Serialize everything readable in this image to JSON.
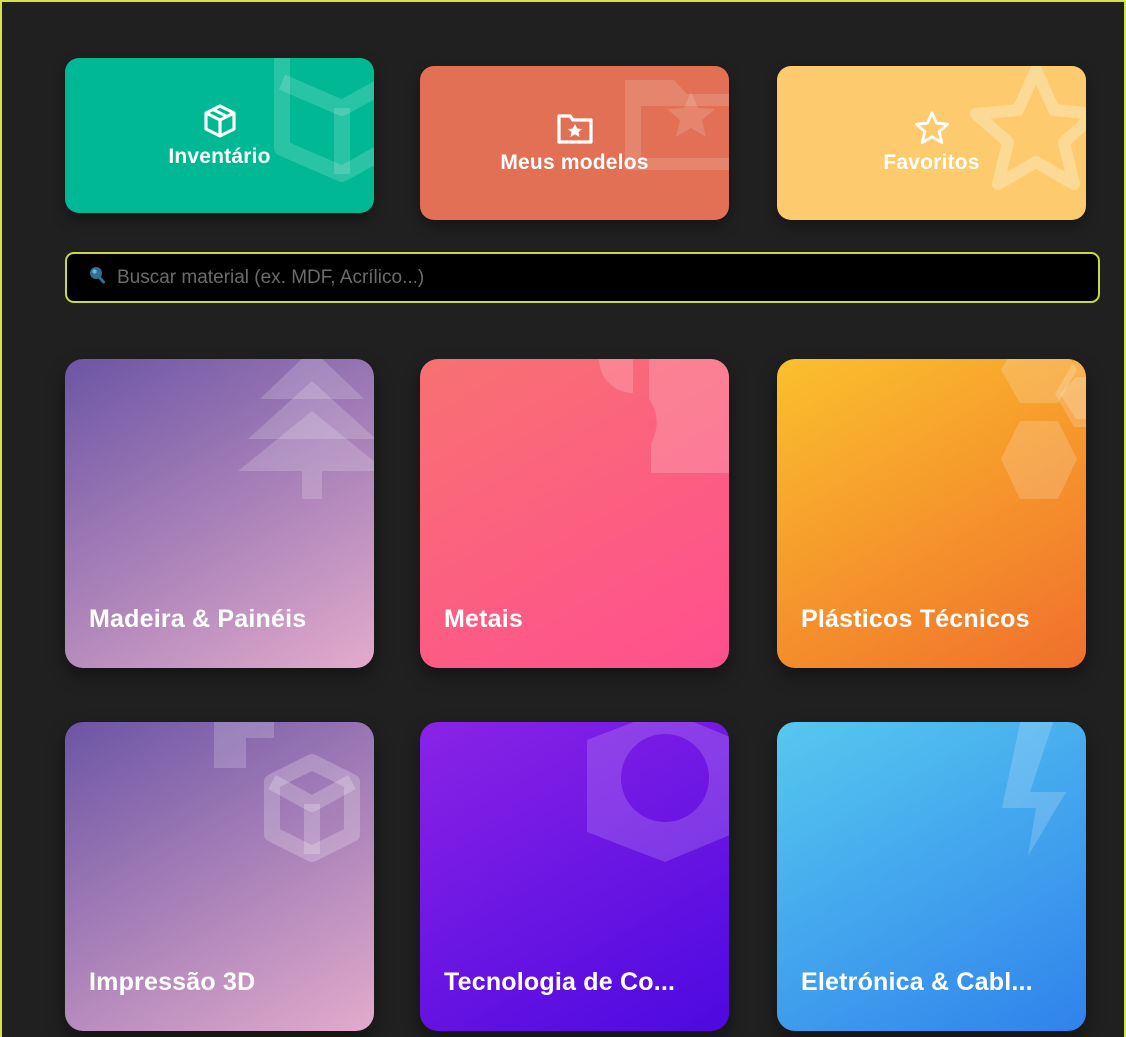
{
  "quick_actions": [
    {
      "label": "Inventário",
      "icon": "box-icon",
      "color": "#00b894"
    },
    {
      "label": "Meus modelos",
      "icon": "folder-star-icon",
      "color": "#e17055"
    },
    {
      "label": "Favoritos",
      "icon": "star-icon",
      "color": "#fdcb6e"
    }
  ],
  "search": {
    "placeholder": "Buscar material (ex. MDF, Acrílico...)",
    "value": "",
    "icon": "search-icon",
    "border_color": "#c9d846"
  },
  "categories": [
    {
      "label": "Madeira & Painéis",
      "icon": "tree-icon",
      "gradient": [
        "#6c55a5",
        "#e2abcb"
      ]
    },
    {
      "label": "Metais",
      "icon": "wrench-icon",
      "gradient": [
        "#f87171",
        "#ff4f8f"
      ]
    },
    {
      "label": "Plásticos Técnicos",
      "icon": "hexagons-icon",
      "gradient": [
        "#fbc02d",
        "#f06f2c"
      ]
    },
    {
      "label": "Impressão 3D",
      "icon": "cube-icon",
      "gradient": [
        "#6c55a5",
        "#e2abcb"
      ]
    },
    {
      "label": "Tecnologia de Co...",
      "icon": "nut-icon",
      "gradient": [
        "#8a23e6",
        "#4d09e0"
      ]
    },
    {
      "label": "Eletrónica & Cabl...",
      "icon": "bolt-icon",
      "gradient": [
        "#56c8ef",
        "#3082ec"
      ]
    }
  ]
}
